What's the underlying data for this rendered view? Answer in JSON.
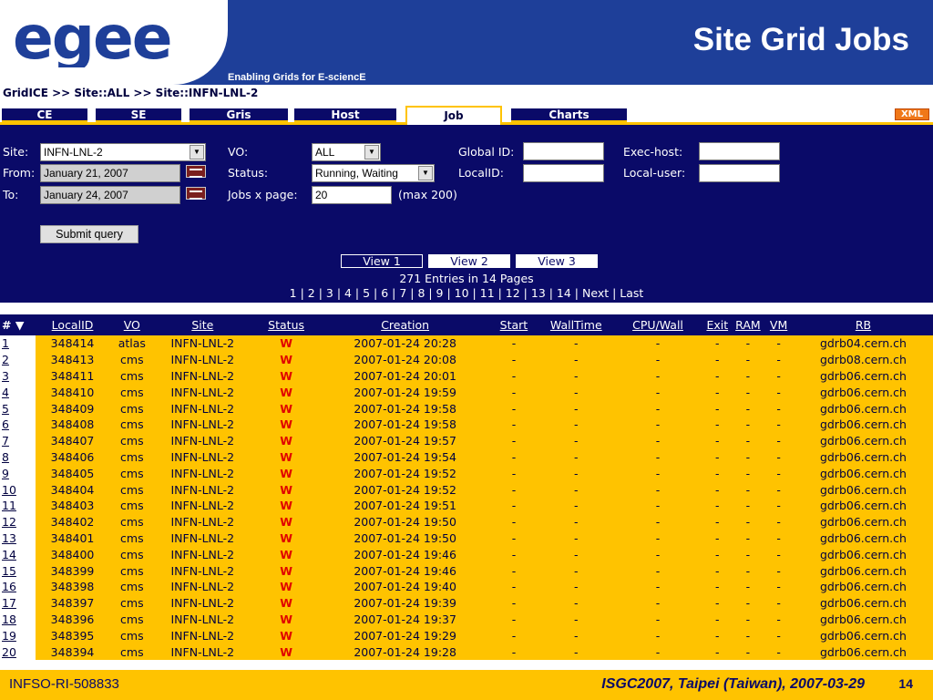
{
  "slide": {
    "logo_text": "egee",
    "tagline": "Enabling Grids for E-sciencE",
    "title": "Site Grid Jobs",
    "footer_left": "INFSO-RI-508833",
    "footer_right": "ISGC2007, Taipei (Taiwan), 2007-03-29",
    "page_number": "14",
    "colors": {
      "band": "#1e3f99",
      "navy": "#0a0a68",
      "gold": "#ffc300",
      "status_red": "#e00000"
    }
  },
  "breadcrumb": "GridICE >> Site::ALL >> Site::INFN-LNL-2",
  "tabs": [
    {
      "label": "CE",
      "active": false
    },
    {
      "label": "SE",
      "active": false
    },
    {
      "label": "Gris",
      "active": false
    },
    {
      "label": "Host",
      "active": false
    },
    {
      "label": "Job",
      "active": true
    },
    {
      "label": "Charts",
      "active": false
    }
  ],
  "xml_badge": "XML",
  "query": {
    "site_label": "Site:",
    "site_value": "INFN-LNL-2",
    "from_label": "From:",
    "from_value": "January 21, 2007",
    "to_label": "To:",
    "to_value": "January 24, 2007",
    "vo_label": "VO:",
    "vo_value": "ALL",
    "status_label": "Status:",
    "status_value": "Running, Waiting",
    "jobs_label": "Jobs x page:",
    "jobs_value": "20",
    "jobs_hint": "(max 200)",
    "global_id_label": "Global ID:",
    "global_id_value": "",
    "local_id_label": "LocalID:",
    "local_id_value": "",
    "exec_host_label": "Exec-host:",
    "exec_host_value": "",
    "local_user_label": "Local-user:",
    "local_user_value": "",
    "submit_label": "Submit query"
  },
  "views": [
    "View 1",
    "View 2",
    "View 3"
  ],
  "active_view": "View 1",
  "entries_text": "271 Entries in 14 Pages",
  "pager_text": "1 | 2 | 3 | 4 | 5 | 6 | 7 | 8 | 9 | 10 | 11 | 12 | 13 | 14 | Next | Last",
  "table": {
    "columns": [
      "# ▼",
      "LocalID",
      "VO",
      "Site",
      "Status",
      "Creation",
      "Start",
      "WallTime",
      "CPU/Wall",
      "Exit",
      "RAM",
      "VM",
      "RB"
    ],
    "rows": [
      [
        "1",
        "348414",
        "atlas",
        "INFN-LNL-2",
        "W",
        "2007-01-24 20:28",
        "-",
        "-",
        "-",
        "-",
        "-",
        "-",
        "gdrb04.cern.ch"
      ],
      [
        "2",
        "348413",
        "cms",
        "INFN-LNL-2",
        "W",
        "2007-01-24 20:08",
        "-",
        "-",
        "-",
        "-",
        "-",
        "-",
        "gdrb08.cern.ch"
      ],
      [
        "3",
        "348411",
        "cms",
        "INFN-LNL-2",
        "W",
        "2007-01-24 20:01",
        "-",
        "-",
        "-",
        "-",
        "-",
        "-",
        "gdrb06.cern.ch"
      ],
      [
        "4",
        "348410",
        "cms",
        "INFN-LNL-2",
        "W",
        "2007-01-24 19:59",
        "-",
        "-",
        "-",
        "-",
        "-",
        "-",
        "gdrb06.cern.ch"
      ],
      [
        "5",
        "348409",
        "cms",
        "INFN-LNL-2",
        "W",
        "2007-01-24 19:58",
        "-",
        "-",
        "-",
        "-",
        "-",
        "-",
        "gdrb06.cern.ch"
      ],
      [
        "6",
        "348408",
        "cms",
        "INFN-LNL-2",
        "W",
        "2007-01-24 19:58",
        "-",
        "-",
        "-",
        "-",
        "-",
        "-",
        "gdrb06.cern.ch"
      ],
      [
        "7",
        "348407",
        "cms",
        "INFN-LNL-2",
        "W",
        "2007-01-24 19:57",
        "-",
        "-",
        "-",
        "-",
        "-",
        "-",
        "gdrb06.cern.ch"
      ],
      [
        "8",
        "348406",
        "cms",
        "INFN-LNL-2",
        "W",
        "2007-01-24 19:54",
        "-",
        "-",
        "-",
        "-",
        "-",
        "-",
        "gdrb06.cern.ch"
      ],
      [
        "9",
        "348405",
        "cms",
        "INFN-LNL-2",
        "W",
        "2007-01-24 19:52",
        "-",
        "-",
        "-",
        "-",
        "-",
        "-",
        "gdrb06.cern.ch"
      ],
      [
        "10",
        "348404",
        "cms",
        "INFN-LNL-2",
        "W",
        "2007-01-24 19:52",
        "-",
        "-",
        "-",
        "-",
        "-",
        "-",
        "gdrb06.cern.ch"
      ],
      [
        "11",
        "348403",
        "cms",
        "INFN-LNL-2",
        "W",
        "2007-01-24 19:51",
        "-",
        "-",
        "-",
        "-",
        "-",
        "-",
        "gdrb06.cern.ch"
      ],
      [
        "12",
        "348402",
        "cms",
        "INFN-LNL-2",
        "W",
        "2007-01-24 19:50",
        "-",
        "-",
        "-",
        "-",
        "-",
        "-",
        "gdrb06.cern.ch"
      ],
      [
        "13",
        "348401",
        "cms",
        "INFN-LNL-2",
        "W",
        "2007-01-24 19:50",
        "-",
        "-",
        "-",
        "-",
        "-",
        "-",
        "gdrb06.cern.ch"
      ],
      [
        "14",
        "348400",
        "cms",
        "INFN-LNL-2",
        "W",
        "2007-01-24 19:46",
        "-",
        "-",
        "-",
        "-",
        "-",
        "-",
        "gdrb06.cern.ch"
      ],
      [
        "15",
        "348399",
        "cms",
        "INFN-LNL-2",
        "W",
        "2007-01-24 19:46",
        "-",
        "-",
        "-",
        "-",
        "-",
        "-",
        "gdrb06.cern.ch"
      ],
      [
        "16",
        "348398",
        "cms",
        "INFN-LNL-2",
        "W",
        "2007-01-24 19:40",
        "-",
        "-",
        "-",
        "-",
        "-",
        "-",
        "gdrb06.cern.ch"
      ],
      [
        "17",
        "348397",
        "cms",
        "INFN-LNL-2",
        "W",
        "2007-01-24 19:39",
        "-",
        "-",
        "-",
        "-",
        "-",
        "-",
        "gdrb06.cern.ch"
      ],
      [
        "18",
        "348396",
        "cms",
        "INFN-LNL-2",
        "W",
        "2007-01-24 19:37",
        "-",
        "-",
        "-",
        "-",
        "-",
        "-",
        "gdrb06.cern.ch"
      ],
      [
        "19",
        "348395",
        "cms",
        "INFN-LNL-2",
        "W",
        "2007-01-24 19:29",
        "-",
        "-",
        "-",
        "-",
        "-",
        "-",
        "gdrb06.cern.ch"
      ],
      [
        "20",
        "348394",
        "cms",
        "INFN-LNL-2",
        "W",
        "2007-01-24 19:28",
        "-",
        "-",
        "-",
        "-",
        "-",
        "-",
        "gdrb06.cern.ch"
      ]
    ]
  }
}
